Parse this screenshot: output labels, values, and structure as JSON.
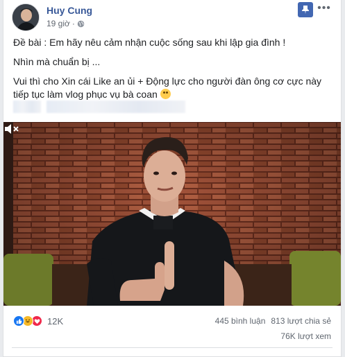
{
  "post": {
    "author": "Huy Cung",
    "time": "19 giờ",
    "dot": "·",
    "paragraphs": {
      "p1": "Đề bài : Em hãy nêu cảm nhận cuộc sống sau khi lập gia đình !",
      "p2": "Nhìn mà chuẩn bị ...",
      "p3": "Vui thì cho Xin cái Like an ủi + Động lực cho người đàn ông cơ cực này tiếp tục làm vlog phục vụ bà coan"
    }
  },
  "footer": {
    "reaction_count": "12K",
    "comments": "445 bình luận",
    "shares": "813 lượt chia sẻ",
    "views": "76K lượt xem"
  },
  "colors": {
    "author_link": "#385898",
    "save_button": "#4267b2",
    "like": "#1877f2",
    "haha": "#f7b928",
    "love": "#f0284a"
  },
  "icons": {
    "privacy": "globe-icon",
    "save": "bookmark-icon",
    "more": "more-options-icon",
    "mute": "speaker-muted-icon"
  }
}
